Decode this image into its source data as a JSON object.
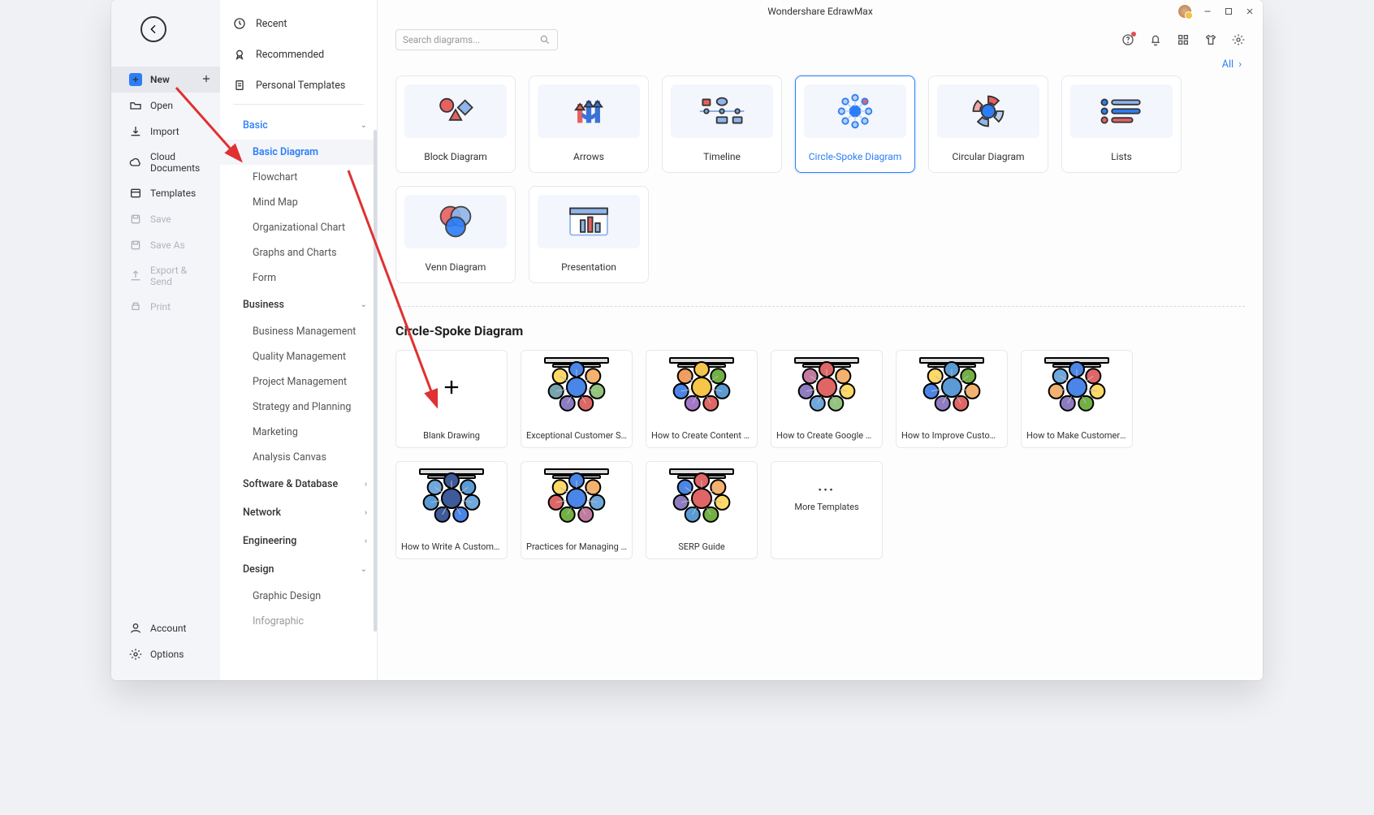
{
  "titlebar": {
    "app_title": "Wondershare EdrawMax"
  },
  "sidebar": {
    "items": [
      {
        "label": "New"
      },
      {
        "label": "Open"
      },
      {
        "label": "Import"
      },
      {
        "label": "Cloud Documents"
      },
      {
        "label": "Templates"
      },
      {
        "label": "Save"
      },
      {
        "label": "Save As"
      },
      {
        "label": "Export & Send"
      },
      {
        "label": "Print"
      }
    ],
    "bottom": [
      {
        "label": "Account"
      },
      {
        "label": "Options"
      }
    ]
  },
  "categories": {
    "top": [
      {
        "label": "Recent"
      },
      {
        "label": "Recommended"
      },
      {
        "label": "Personal Templates"
      }
    ],
    "basic": {
      "title": "Basic",
      "subs": [
        "Basic Diagram",
        "Flowchart",
        "Mind Map",
        "Organizational Chart",
        "Graphs and Charts",
        "Form"
      ]
    },
    "business": {
      "title": "Business",
      "subs": [
        "Business Management",
        "Quality Management",
        "Project Management",
        "Strategy and Planning",
        "Marketing",
        "Analysis Canvas"
      ]
    },
    "others": [
      "Software & Database",
      "Network",
      "Engineering",
      "Design"
    ],
    "design_subs": [
      "Graphic Design",
      "Infographic"
    ]
  },
  "search": {
    "placeholder": "Search diagrams..."
  },
  "all_link": "All",
  "types": [
    "Block Diagram",
    "Arrows",
    "Timeline",
    "Circle-Spoke Diagram",
    "Circular Diagram",
    "Lists",
    "Venn Diagram",
    "Presentation"
  ],
  "selected_type_index": 3,
  "section_title": "Circle-Spoke Diagram",
  "templates": [
    "Blank Drawing",
    "Exceptional Customer Serv...",
    "How to Create Content Ma...",
    "How to Create Google Ads...",
    "How to Improve Customer...",
    "How to Make Customers B...",
    "How to Write A Customer ...",
    "Practices for Managing Cli...",
    "SERP Guide"
  ],
  "more_templates_label": "More Templates"
}
